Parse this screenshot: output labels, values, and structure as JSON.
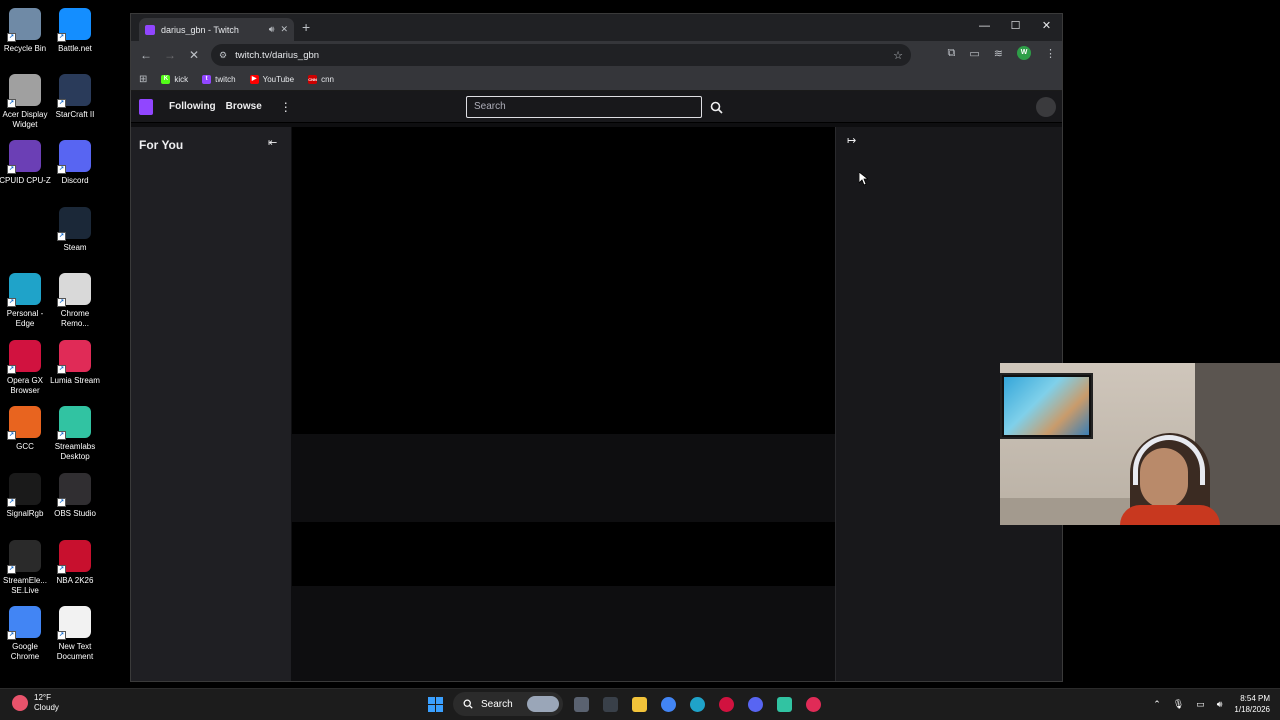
{
  "desktop": {
    "icons": [
      {
        "label": "Recycle Bin",
        "icon": "recycle-bin-icon",
        "color": "#6f8aa6"
      },
      {
        "label": "Battle.net",
        "icon": "battlenet-icon",
        "color": "#148eff"
      },
      {
        "label": "Acer Display Widget",
        "icon": "acer-display-widget-icon",
        "color": "#a0a0a0"
      },
      {
        "label": "StarCraft II",
        "icon": "starcraft-icon",
        "color": "#2a3b5a"
      },
      {
        "label": "CPUID CPU-Z",
        "icon": "cpuz-icon",
        "color": "#6b3fb5"
      },
      {
        "label": "Discord",
        "icon": "discord-icon",
        "color": "#5865f2"
      },
      {
        "label": "Steam",
        "icon": "steam-icon",
        "color": "#1b2838"
      },
      {
        "label": "Personal - Edge",
        "icon": "edge-icon",
        "color": "#1fa3c9"
      },
      {
        "label": "Chrome Remo...",
        "icon": "chrome-remote-icon",
        "color": "#d9d9d9"
      },
      {
        "label": "Opera GX Browser",
        "icon": "opera-gx-icon",
        "color": "#d1123f"
      },
      {
        "label": "Lumia Stream",
        "icon": "lumia-stream-icon",
        "color": "#e02b57"
      },
      {
        "label": "GCC",
        "icon": "gcc-icon",
        "color": "#e8641f"
      },
      {
        "label": "Streamlabs Desktop",
        "icon": "streamlabs-icon",
        "color": "#31c3a2"
      },
      {
        "label": "SignalRgb",
        "icon": "signalrgb-icon",
        "color": "#1a1a1a"
      },
      {
        "label": "OBS Studio",
        "icon": "obs-icon",
        "color": "#302e31"
      },
      {
        "label": "StreamEle... SE.Live",
        "icon": "streamelements-icon",
        "color": "#2a2a2a"
      },
      {
        "label": "NBA 2K26",
        "icon": "nba2k-icon",
        "color": "#c8102e"
      },
      {
        "label": "Google Chrome",
        "icon": "chrome-icon",
        "color": "#4285f4"
      },
      {
        "label": "New Text Document",
        "icon": "text-document-icon",
        "color": "#f2f2f2"
      }
    ]
  },
  "browser": {
    "tab_title": "darius_gbn - Twitch",
    "new_tab": "+",
    "url": "twitch.tv/darius_gbn",
    "profile_initial": "W",
    "bookmarks": [
      {
        "label": "kick",
        "color": "#53fc18",
        "glyph": "K"
      },
      {
        "label": "twitch",
        "color": "#9146ff",
        "glyph": "t"
      },
      {
        "label": "YouTube",
        "color": "#ff0000",
        "glyph": "▶"
      },
      {
        "label": "cnn",
        "color": "#cc0000",
        "glyph": "CNN"
      }
    ]
  },
  "twitch": {
    "nav_following": "Following",
    "nav_browse": "Browse",
    "search_placeholder": "Search",
    "sidebar_title": "For You",
    "accent": "#9146ff"
  },
  "taskbar": {
    "weather_temp": "12°F",
    "weather_desc": "Cloudy",
    "search_label": "Search",
    "time": "8:54 PM",
    "date": "1/18/2026"
  }
}
